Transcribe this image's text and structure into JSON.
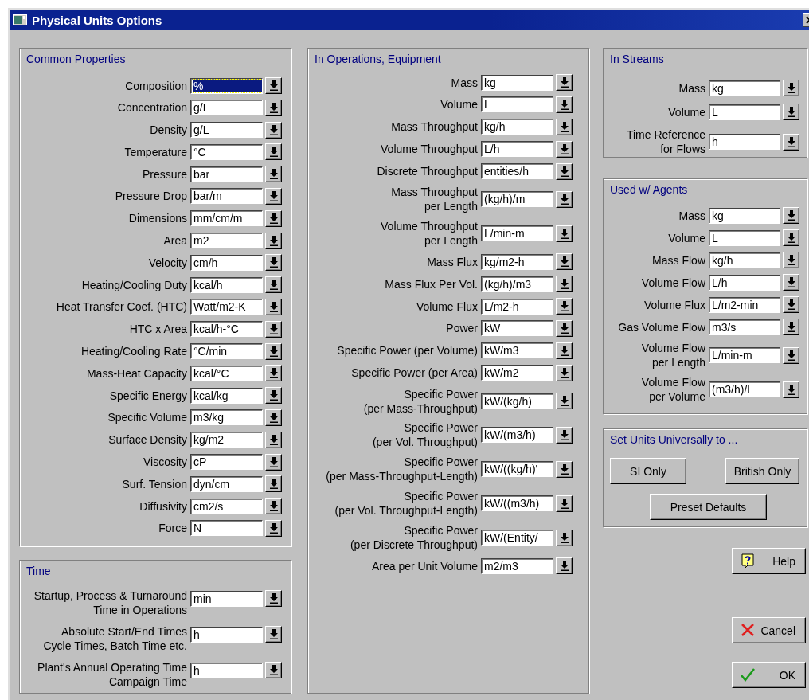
{
  "window": {
    "title": "Physical Units Options"
  },
  "columns": [
    {
      "panels": [
        {
          "title": "Common Properties",
          "rows": [
            {
              "label": "Composition",
              "value": "%",
              "focused": true
            },
            {
              "label": "Concentration",
              "value": "g/L",
              "focused": false
            },
            {
              "label": "Density",
              "value": "g/L",
              "focused": false
            },
            {
              "label": "Temperature",
              "value": "°C",
              "focused": false
            },
            {
              "label": "Pressure",
              "value": "bar",
              "focused": false
            },
            {
              "label": "Pressure Drop",
              "value": "bar/m",
              "focused": false
            },
            {
              "label": "Dimensions",
              "value": "mm/cm/m",
              "focused": false
            },
            {
              "label": "Area",
              "value": "m2",
              "focused": false
            },
            {
              "label": "Velocity",
              "value": "cm/h",
              "focused": false
            },
            {
              "label": "Heating/Cooling Duty",
              "value": "kcal/h",
              "focused": false
            },
            {
              "label": "Heat Transfer Coef. (HTC)",
              "value": "Watt/m2-K",
              "focused": false
            },
            {
              "label": "HTC x Area",
              "value": "kcal/h-°C",
              "focused": false
            },
            {
              "label": "Heating/Cooling Rate",
              "value": "°C/min",
              "focused": false
            },
            {
              "label": "Mass-Heat Capacity",
              "value": "kcal/°C",
              "focused": false
            },
            {
              "label": "Specific Energy",
              "value": "kcal/kg",
              "focused": false
            },
            {
              "label": "Specific Volume",
              "value": "m3/kg",
              "focused": false
            },
            {
              "label": "Surface Density",
              "value": "kg/m2",
              "focused": false
            },
            {
              "label": "Viscosity",
              "value": "cP",
              "focused": false
            },
            {
              "label": "Surf. Tension",
              "value": "dyn/cm",
              "focused": false
            },
            {
              "label": "Diffusivity",
              "value": "cm2/s",
              "focused": false
            },
            {
              "label": "Force",
              "value": "N",
              "focused": false
            }
          ]
        },
        {
          "title": "Time",
          "rows": [
            {
              "label": "Startup, Process & Turnaround\nTime in Operations",
              "value": "min",
              "focused": false
            },
            {
              "label": "Absolute Start/End Times\nCycle Times, Batch Time etc.",
              "value": "h",
              "focused": false
            },
            {
              "label": "Plant's Annual Operating Time\nCampaign Time",
              "value": "h",
              "focused": false
            }
          ]
        }
      ]
    },
    {
      "panels": [
        {
          "title": "In Operations, Equipment",
          "rows": [
            {
              "label": "Mass",
              "value": "kg",
              "focused": false
            },
            {
              "label": "Volume",
              "value": "L",
              "focused": false
            },
            {
              "label": "Mass Throughput",
              "value": "kg/h",
              "focused": false
            },
            {
              "label": "Volume Throughput",
              "value": "L/h",
              "focused": false
            },
            {
              "label": "Discrete Throughput",
              "value": "entities/h",
              "focused": false
            },
            {
              "label": "Mass Throughput\nper Length",
              "value": "(kg/h)/m",
              "focused": false
            },
            {
              "label": "Volume Throughput\nper Length",
              "value": "L/min-m",
              "focused": false
            },
            {
              "label": "Mass Flux",
              "value": "kg/m2-h",
              "focused": false
            },
            {
              "label": "Mass Flux Per Vol.",
              "value": "(kg/h)/m3",
              "focused": false
            },
            {
              "label": "Volume Flux",
              "value": "L/m2-h",
              "focused": false
            },
            {
              "label": "Power",
              "value": "kW",
              "focused": false
            },
            {
              "label": "Specific Power (per Volume)",
              "value": "kW/m3",
              "focused": false
            },
            {
              "label": "Specific Power (per Area)",
              "value": "kW/m2",
              "focused": false
            },
            {
              "label": "Specific Power\n(per Mass-Throughput)",
              "value": "kW/(kg/h)",
              "focused": false
            },
            {
              "label": "Specific Power\n(per Vol. Throughput)",
              "value": "kW/(m3/h)",
              "focused": false
            },
            {
              "label": "Specific Power\n(per Mass-Throughput-Length)",
              "value": "kW/((kg/h)'",
              "focused": false
            },
            {
              "label": "Specific Power\n(per Vol. Throughput-Length)",
              "value": "kW/((m3/h)",
              "focused": false
            },
            {
              "label": "Specific Power\n(per Discrete Throughput)",
              "value": "kW/(Entity/",
              "focused": false
            },
            {
              "label": "Area per Unit Volume",
              "value": "m2/m3",
              "focused": false
            }
          ]
        }
      ]
    },
    {
      "panels": [
        {
          "title": "In Streams",
          "rows": [
            {
              "label": "Mass",
              "value": "kg",
              "focused": false
            },
            {
              "label": "Volume",
              "value": "L",
              "focused": false
            },
            {
              "label": "Time Reference\nfor Flows",
              "value": "h",
              "focused": false
            }
          ]
        },
        {
          "title": "Used w/ Agents",
          "rows": [
            {
              "label": "Mass",
              "value": "kg",
              "focused": false
            },
            {
              "label": "Volume",
              "value": "L",
              "focused": false
            },
            {
              "label": "Mass Flow",
              "value": "kg/h",
              "focused": false
            },
            {
              "label": "Volume Flow",
              "value": "L/h",
              "focused": false
            },
            {
              "label": "Volume Flux",
              "value": "L/m2-min",
              "focused": false
            },
            {
              "label": "Gas Volume Flow",
              "value": "m3/s",
              "focused": false
            },
            {
              "label": "Volume Flow\nper Length",
              "value": "L/min-m",
              "focused": false
            },
            {
              "label": "Volume Flow\nper Volume",
              "value": "(m3/h)/L",
              "focused": false
            }
          ]
        }
      ]
    }
  ],
  "universal": {
    "title": "Set Units Universally to ...",
    "buttons": [
      "SI Only",
      "British Only",
      "Preset Defaults"
    ]
  },
  "dialog_buttons": [
    {
      "kind": "help",
      "label": "Help"
    },
    {
      "kind": "cancel",
      "label": "Cancel"
    },
    {
      "kind": "ok",
      "label": "OK"
    }
  ]
}
